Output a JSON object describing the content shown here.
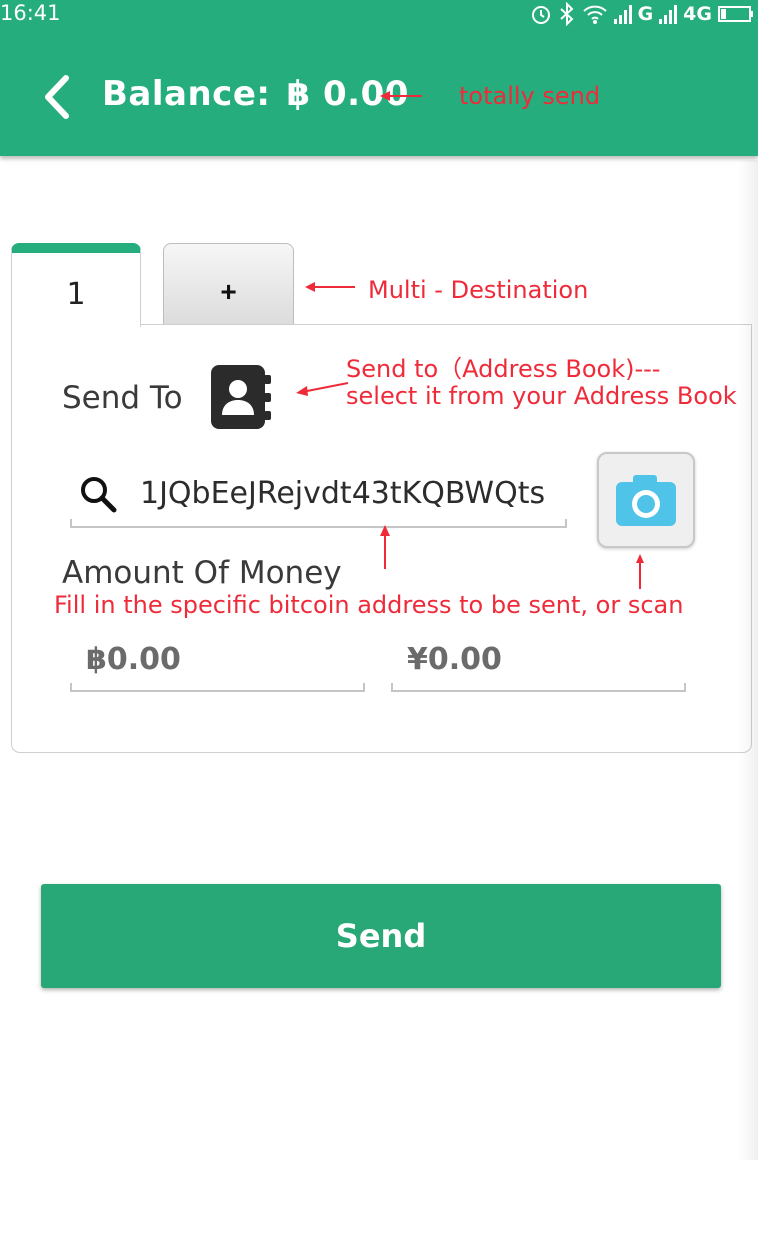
{
  "status_bar": {
    "time": "16:41",
    "network_g": "G",
    "network_4g": "4G"
  },
  "header": {
    "balance_label": "Balance:",
    "currency_symbol": "฿",
    "balance_value": "0.00"
  },
  "annotations": {
    "balance": "totally send",
    "tabs": "Multi - Destination",
    "address_book_line1": "Send to（Address Book)---",
    "address_book_line2": "select it from your Address Book",
    "address_field": "Fill in the specific bitcoin address to be sent, or scan"
  },
  "tabs": [
    {
      "label": "1",
      "active": true
    },
    {
      "label": "+",
      "active": false
    }
  ],
  "form": {
    "send_to_label": "Send To",
    "address_value": "1JQbEeJRejvdt43tKQBWQts",
    "amount_label": "Amount Of Money",
    "btc_amount_placeholder": "฿0.00",
    "cny_amount_placeholder": "¥0.00"
  },
  "send_button": "Send",
  "colors": {
    "brand_green": "#26ad7e",
    "annotation_red": "#ef2b3a",
    "camera_blue": "#4fc3e8"
  },
  "icons": [
    "back-icon",
    "address-book-icon",
    "search-icon",
    "camera-icon",
    "alarm-icon",
    "bluetooth-icon",
    "wifi-icon",
    "signal-icon",
    "battery-icon"
  ]
}
